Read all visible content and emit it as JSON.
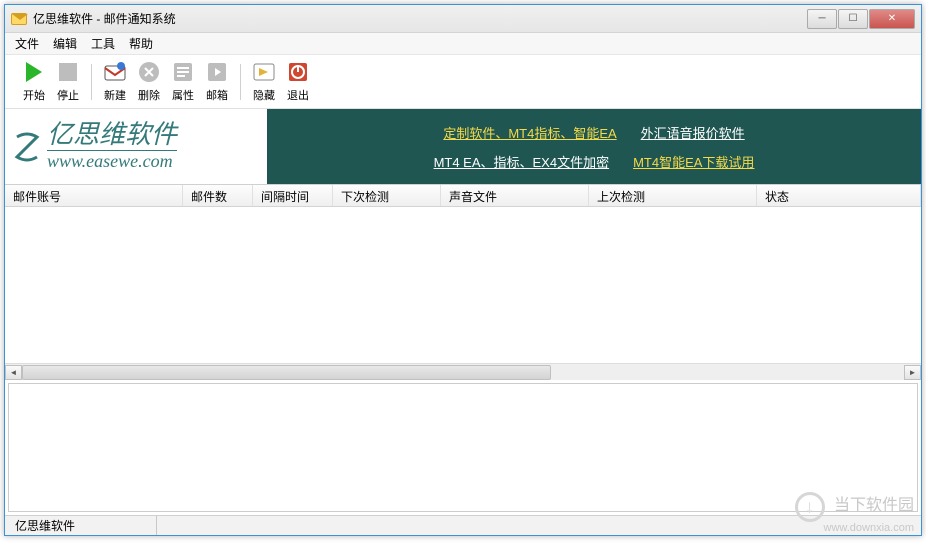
{
  "window": {
    "title": "亿思维软件 - 邮件通知系统"
  },
  "menu": {
    "file": "文件",
    "edit": "编辑",
    "tools": "工具",
    "help": "帮助"
  },
  "toolbar": {
    "start": "开始",
    "stop": "停止",
    "new": "新建",
    "delete": "删除",
    "properties": "属性",
    "mailbox": "邮箱",
    "hide": "隐藏",
    "exit": "退出"
  },
  "banner": {
    "company_cn": "亿思维软件",
    "company_en": "www.easewe.com",
    "link1": "定制软件、MT4指标、智能EA",
    "link2": "外汇语音报价软件",
    "link3": "MT4 EA、指标、EX4文件加密",
    "link4": "MT4智能EA下载试用"
  },
  "table": {
    "columns": {
      "account": "邮件账号",
      "count": "邮件数",
      "interval": "间隔时间",
      "next_check": "下次检测",
      "sound_file": "声音文件",
      "last_check": "上次检测",
      "status": "状态"
    },
    "rows": []
  },
  "statusbar": {
    "text": "亿思维软件"
  },
  "watermark": {
    "cn": "当下软件园",
    "en": "www.downxia.com"
  }
}
